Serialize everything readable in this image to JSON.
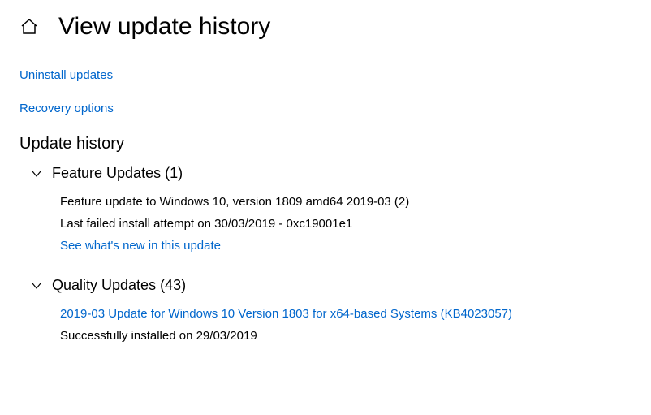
{
  "header": {
    "title": "View update history"
  },
  "links": {
    "uninstall": "Uninstall updates",
    "recovery": "Recovery options"
  },
  "section": {
    "title": "Update history"
  },
  "groups": {
    "feature": {
      "label": "Feature Updates (1)",
      "entry_title": "Feature update to Windows 10, version 1809 amd64 2019-03 (2)",
      "entry_status": "Last failed install attempt on 30/03/2019 - 0xc19001e1",
      "whats_new": "See what's new in this update"
    },
    "quality": {
      "label": "Quality Updates (43)",
      "entry_title": "2019-03 Update for Windows 10 Version 1803 for x64-based Systems (KB4023057)",
      "entry_status": "Successfully installed on 29/03/2019"
    }
  }
}
